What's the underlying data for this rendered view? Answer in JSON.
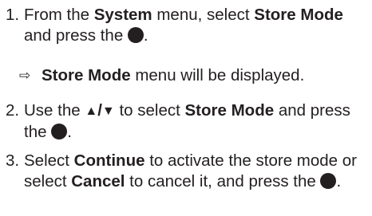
{
  "steps": [
    {
      "number": "1.",
      "t1": "From the ",
      "b1": "System",
      "t2": " menu, select ",
      "b2": "Store Mode",
      "t3": " and press the ",
      "t4": "."
    },
    {
      "number": "2.",
      "t1": "Use the ",
      "up": "▲",
      "slash": "/",
      "down": "▼",
      "t2": " to select ",
      "b1": "Store Mode",
      "t3": " and press the ",
      "t4": "."
    },
    {
      "number": "3.",
      "t1": "Select ",
      "b1": "Continue",
      "t2": " to activate the store mode or select ",
      "b2": "Cancel",
      "t3": " to cancel it, and press the ",
      "t4": "."
    }
  ],
  "result": {
    "arrow": "⇨",
    "b1": "Store Mode",
    "t1": " menu will be displayed."
  },
  "icons": {
    "ok_button": "filled-circle-icon",
    "up_arrow": "up-triangle-icon",
    "down_arrow": "down-triangle-icon",
    "result_arrow": "result-arrow-icon"
  },
  "colors": {
    "text": "#231f20"
  }
}
